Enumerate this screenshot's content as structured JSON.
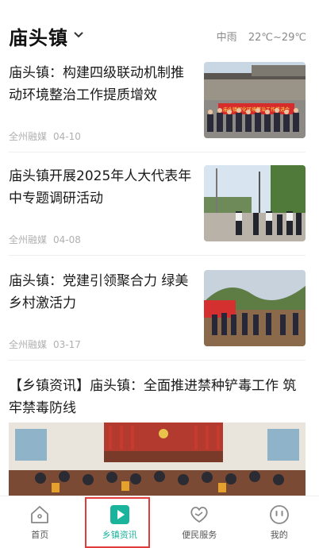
{
  "header": {
    "town": "庙头镇",
    "weather_desc": "中雨",
    "temperature": "22℃~29℃"
  },
  "news": [
    {
      "title": "庙头镇：构建四级联动机制推动环境整治工作提质增效",
      "source": "全州融媒",
      "date": "04-10",
      "banner_text": "庙头镇深化环境整治工作推进会"
    },
    {
      "title": "庙头镇开展2025年人大代表年中专题调研活动",
      "source": "全州融媒",
      "date": "04-08"
    },
    {
      "title": "庙头镇：党建引领聚合力 绿美乡村激活力",
      "source": "全州融媒",
      "date": "03-17"
    }
  ],
  "featured": {
    "title": "【乡镇资讯】庙头镇：全面推进禁种铲毒工作 筑牢禁毒防线"
  },
  "tabbar": {
    "items": [
      {
        "label": "首页",
        "icon": "home-icon"
      },
      {
        "label": "乡镇资讯",
        "icon": "play-icon"
      },
      {
        "label": "便民服务",
        "icon": "heart-handshake-icon"
      },
      {
        "label": "我的",
        "icon": "face-icon"
      }
    ],
    "active_index": 1,
    "accent_color": "#1ab39b"
  }
}
